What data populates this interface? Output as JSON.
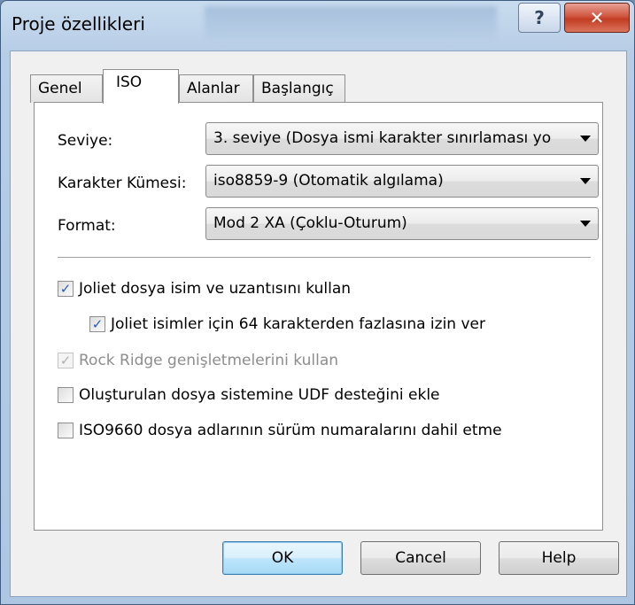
{
  "window": {
    "title": "Proje özellikleri",
    "help_button_label": "?",
    "close_button_label": "✕"
  },
  "tabs": [
    {
      "label": "Genel"
    },
    {
      "label": "ISO"
    },
    {
      "label": "Alanlar"
    },
    {
      "label": "Başlangıç"
    }
  ],
  "active_tab": "ISO",
  "fields": {
    "level": {
      "label": "Seviye:",
      "value": "3. seviye (Dosya ismi karakter sınırlaması yo"
    },
    "charset": {
      "label": "Karakter Kümesi:",
      "value": "iso8859-9 (Otomatik algılama)"
    },
    "format": {
      "label": "Format:",
      "value": "Mod 2 XA (Çoklu-Oturum)"
    }
  },
  "options": [
    {
      "label": "Joliet dosya isim ve uzantısını kullan",
      "checked": true,
      "enabled": true
    },
    {
      "label": "Joliet isimler için 64 karakterden fazlasına izin ver",
      "checked": true,
      "enabled": true
    },
    {
      "label": "Rock Ridge genişletmelerini kullan",
      "checked": true,
      "enabled": false
    },
    {
      "label": "Oluşturulan dosya sistemine UDF desteğini ekle",
      "checked": false,
      "enabled": true
    },
    {
      "label": "ISO9660 dosya adlarının sürüm numaralarını dahil etme",
      "checked": false,
      "enabled": true
    }
  ],
  "buttons": {
    "ok": "OK",
    "cancel": "Cancel",
    "help": "Help"
  },
  "colors": {
    "check_mark": "#2b5bb0",
    "close_button": "#c23c22",
    "default_button_border": "#3c7fb1"
  }
}
